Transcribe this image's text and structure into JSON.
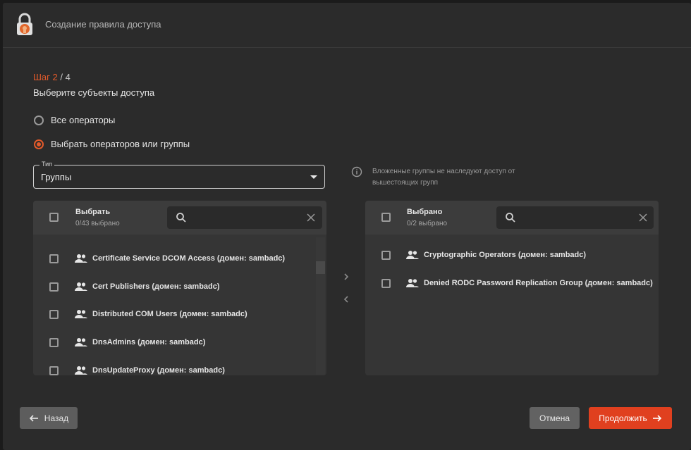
{
  "header": {
    "title": "Создание правила доступа",
    "logo_icon": "lock-logo-icon"
  },
  "step": {
    "current": "Шаг 2",
    "total": " / 4",
    "subtitle": "Выберите субъекты доступа"
  },
  "radios": [
    {
      "label": "Все операторы",
      "checked": false
    },
    {
      "label": "Выбрать операторов или группы",
      "checked": true
    }
  ],
  "type_select": {
    "legend": "Тип",
    "value": "Группы"
  },
  "info": {
    "text": "Вложенные группы не наследуют доступ от вышестоящих групп"
  },
  "left_panel": {
    "title": "Выбрать",
    "count": "0/43 выбрано",
    "search_placeholder": "",
    "items": [
      {
        "label": "Certificate Service DCOM Access (домен: sambadc)"
      },
      {
        "label": "Cert Publishers (домен: sambadc)"
      },
      {
        "label": "Distributed COM Users (домен: sambadc)"
      },
      {
        "label": "DnsAdmins (домен: sambadc)"
      },
      {
        "label": "DnsUpdateProxy (домен: sambadc)"
      }
    ]
  },
  "right_panel": {
    "title": "Выбрано",
    "count": "0/2 выбрано",
    "search_placeholder": "",
    "items": [
      {
        "label": "Cryptographic Operators (домен: sambadc)"
      },
      {
        "label": "Denied RODC Password Replication Group (домен: sambadc)"
      }
    ]
  },
  "buttons": {
    "back": "Назад",
    "cancel": "Отмена",
    "continue": "Продолжить"
  },
  "colors": {
    "accent": "#e25a2b",
    "primary_button": "#e0401f",
    "background": "#2b2b2b"
  }
}
